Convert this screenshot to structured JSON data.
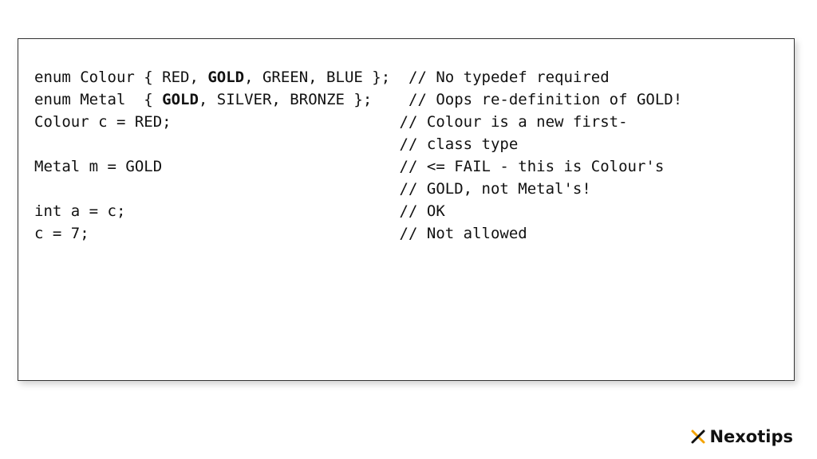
{
  "code": {
    "l1a": "enum Colour { RED, ",
    "l1b": "GOLD",
    "l1c": ", GREEN, BLUE };  // No typedef required",
    "l2a": "enum Metal  { ",
    "l2b": "GOLD",
    "l2c": ", SILVER, BRONZE };    // Oops re-definition of GOLD!",
    "l3": "",
    "l4": "Colour c = RED;                         // Colour is a new first-",
    "l5": "                                        // class type",
    "l6": "",
    "l7": "Metal m = GOLD                          // <= FAIL - this is Colour's",
    "l8": "                                        // GOLD, not Metal's!",
    "l9": "",
    "l10": "int a = c;                              // OK",
    "l11": "c = 7;                                  // Not allowed"
  },
  "brand": {
    "name": "Nexotips"
  }
}
